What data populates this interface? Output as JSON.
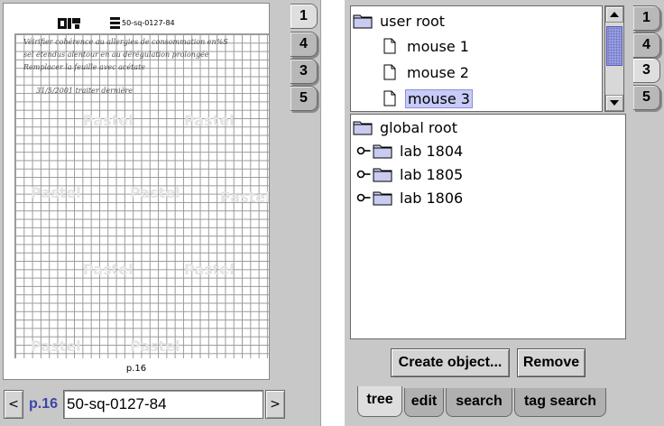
{
  "left": {
    "doc_code": "50-sq-0127-84",
    "page_footer": "p.16",
    "handwriting": [
      "Véirifier cohérence au allergies de consommation en%S",
      "sel étendus alentour en au dérégulation prolongée",
      "Remplacer la feuille avec acétate",
      "31/5/2001    traiter dernière"
    ],
    "watermark": "Pastel",
    "side_tabs": [
      "1",
      "4",
      "3",
      "5"
    ],
    "nav": {
      "prev": "<",
      "page_label": "p.16",
      "page_value": "50-sq-0127-84",
      "next": ">"
    }
  },
  "right": {
    "user_tree": {
      "root_label": "user root",
      "items": [
        "mouse 1",
        "mouse 2",
        "mouse 3"
      ],
      "selected": "mouse 3"
    },
    "global_tree": {
      "root_label": "global root",
      "items": [
        "lab 1804",
        "lab 1805",
        "lab 1806"
      ]
    },
    "buttons": {
      "create": "Create object...",
      "remove": "Remove"
    },
    "bottom_tabs": [
      "tree",
      "edit",
      "search",
      "tag search"
    ],
    "active_bottom_tab": "tree",
    "side_tabs": [
      "1",
      "4",
      "3",
      "5"
    ],
    "active_side_tab": "3"
  }
}
